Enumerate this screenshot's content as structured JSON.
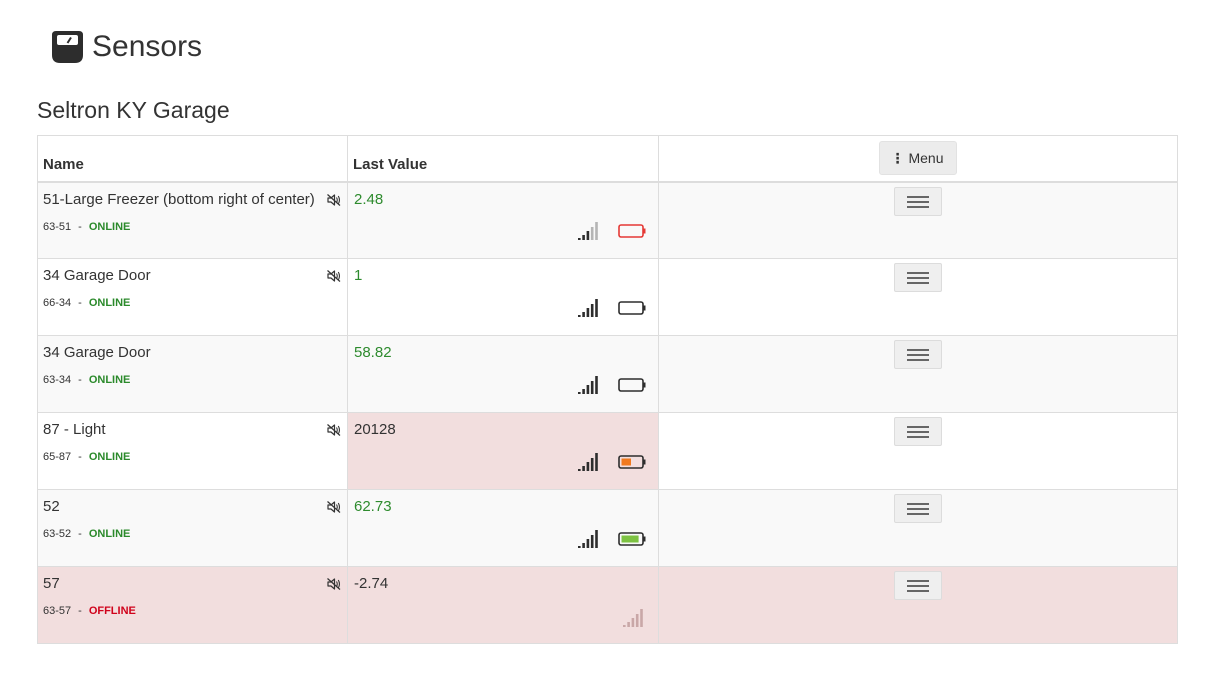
{
  "page": {
    "title": "Sensors",
    "icon": "scale-icon"
  },
  "location": {
    "title": "Seltron KY Garage"
  },
  "table": {
    "columns": {
      "name": "Name",
      "last_value": "Last Value",
      "menu": "Menu"
    },
    "rows": [
      {
        "name": "51-Large Freezer (bottom right of center)",
        "id": "63-51",
        "separator": "-",
        "status": "ONLINE",
        "muted": true,
        "value": "2.48",
        "value_state": "normal",
        "signal_bars": 3,
        "battery_level": 0,
        "battery_color": "#e53935"
      },
      {
        "name": "34 Garage Door",
        "id": "66-34",
        "separator": "-",
        "status": "ONLINE",
        "muted": true,
        "value": "1",
        "value_state": "normal",
        "signal_bars": 5,
        "battery_level": 0,
        "battery_color": "#333333"
      },
      {
        "name": "34 Garage Door",
        "id": "63-34",
        "separator": "-",
        "status": "ONLINE",
        "muted": false,
        "value": "58.82",
        "value_state": "normal",
        "signal_bars": 5,
        "battery_level": 0,
        "battery_color": "#333333"
      },
      {
        "name": "87 - Light",
        "id": "65-87",
        "separator": "-",
        "status": "ONLINE",
        "muted": true,
        "value": "20128",
        "value_state": "alert",
        "signal_bars": 5,
        "battery_level": 0.5,
        "battery_color": "#f0791e"
      },
      {
        "name": "52",
        "id": "63-52",
        "separator": "-",
        "status": "ONLINE",
        "muted": true,
        "value": "62.73",
        "value_state": "normal",
        "signal_bars": 5,
        "battery_level": 0.9,
        "battery_color": "#7dc242"
      },
      {
        "name": "57",
        "id": "63-57",
        "separator": "-",
        "status": "OFFLINE",
        "muted": true,
        "value": "-2.74",
        "value_state": "alert",
        "signal_bars": 0,
        "battery_level": null,
        "battery_color": null
      }
    ]
  },
  "colors": {
    "online": "#2b8a2b",
    "offline": "#d0021b",
    "value_ok": "#2e8b2e",
    "alert_row": "#f2dede"
  }
}
